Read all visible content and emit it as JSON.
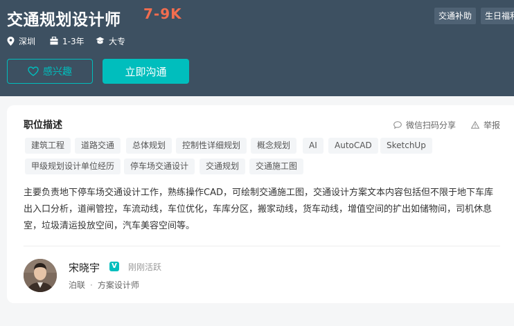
{
  "job": {
    "title": "交通规划设计师",
    "salary": "7-9K",
    "benefits": [
      "交通补助",
      "生日福利"
    ],
    "location": "深圳",
    "experience": "1-3年",
    "education": "大专"
  },
  "actions": {
    "interest_label": "感兴趣",
    "chat_label": "立即沟通"
  },
  "description": {
    "title": "职位描述",
    "share_label": "微信扫码分享",
    "report_label": "举报",
    "tags": [
      "建筑工程",
      "道路交通",
      "总体规划",
      "控制性详细规划",
      "概念规划",
      "AI",
      "AutoCAD",
      "SketchUp",
      "甲级规划设计单位经历",
      "停车场交通设计",
      "交通规划",
      "交通施工图"
    ],
    "text": "主要负责地下停车场交通设计工作，熟练操作CAD，可绘制交通施工图，交通设计方案文本内容包括但不限于地下车库出入口分析，道闸管控，车流动线，车位优化，车库分区，搬家动线，货车动线，增值空间的扩出如储物间，司机休息室，垃圾清运投放空间，汽车美容空间等。"
  },
  "recruiter": {
    "name": "宋晓宇",
    "status": "刚刚活跃",
    "company": "泊联",
    "separator": "·",
    "position": "方案设计师"
  },
  "colors": {
    "header_bg": "#3d5061",
    "accent": "#00bebd",
    "salary": "#f26d4f"
  }
}
